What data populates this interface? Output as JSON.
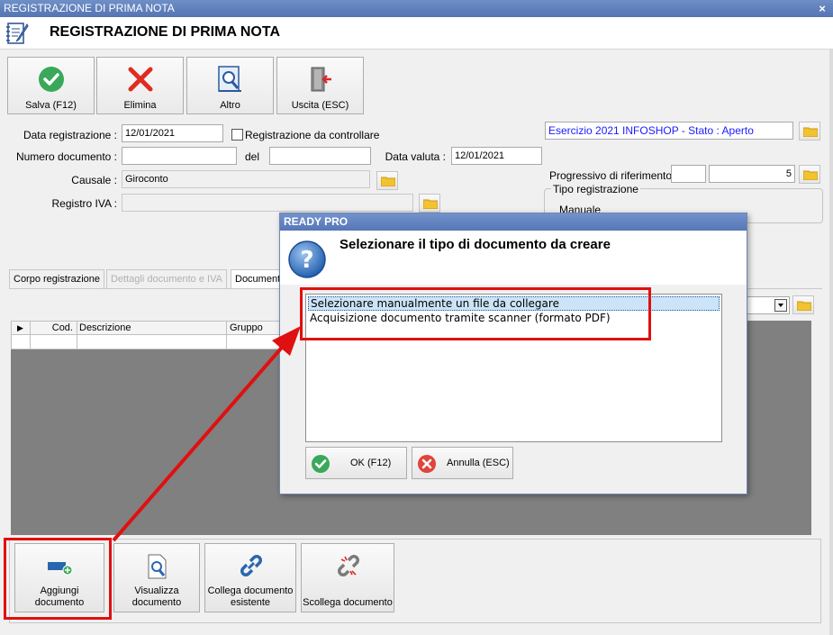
{
  "window": {
    "title": "REGISTRAZIONE DI PRIMA NOTA",
    "close_glyph": "×"
  },
  "header": {
    "title": "REGISTRAZIONE DI PRIMA NOTA",
    "icon": "notebook-edit-icon"
  },
  "toolbar": [
    {
      "label": "Salva (F12)",
      "icon": "check-circle-icon"
    },
    {
      "label": "Elimina",
      "icon": "red-x-icon"
    },
    {
      "label": "Altro",
      "icon": "magnifier-document-icon"
    },
    {
      "label": "Uscita (ESC)",
      "icon": "exit-door-icon"
    }
  ],
  "form": {
    "data_registrazione_label": "Data registrazione :",
    "data_registrazione_value": "12/01/2021",
    "da_controllare_label": "Registrazione da controllare",
    "numero_documento_label": "Numero documento :",
    "numero_documento_value": "",
    "del_label": "del",
    "del_value": "",
    "data_valuta_label": "Data valuta :",
    "data_valuta_value": "12/01/2021",
    "causale_label": "Causale :",
    "causale_value": "Giroconto",
    "registro_iva_label": "Registro IVA :",
    "registro_iva_value": ""
  },
  "right_panel": {
    "esercizio": "Esercizio 2021 INFOSHOP - Stato : Aperto",
    "progressivo_label": "Progressivo di riferimento :",
    "progressivo_prefix": "",
    "progressivo_value": "5",
    "tipo_registrazione_label": "Tipo registrazione",
    "tipo_registrazione_value": "Manuale"
  },
  "tabs": [
    {
      "label": "Corpo registrazione",
      "disabled": false
    },
    {
      "label": "Dettagli documento e IVA",
      "disabled": true
    },
    {
      "label": "Documenti",
      "disabled": false
    }
  ],
  "grid": {
    "columns": [
      "Cod.",
      "Descrizione",
      "Gruppo"
    ]
  },
  "doc_buttons": [
    {
      "label": "Aggiungi documento",
      "icon": "add-document-icon"
    },
    {
      "label": "Visualizza documento",
      "icon": "view-document-icon"
    },
    {
      "label": "Collega documento esistente",
      "icon": "link-icon"
    },
    {
      "label": "Scollega documento",
      "icon": "unlink-icon"
    }
  ],
  "dialog": {
    "title": "READY PRO",
    "heading": "Selezionare il tipo di documento da creare",
    "options": [
      "Selezionare manualmente un file da collegare",
      "Acquisizione documento tramite scanner (formato PDF)"
    ],
    "selected_index": 0,
    "ok_label": "OK (F12)",
    "cancel_label": "Annulla (ESC)"
  },
  "colors": {
    "highlight": "#e01010",
    "title_bar": "#5f7fbf",
    "esercizio_text": "#1a1aff"
  }
}
